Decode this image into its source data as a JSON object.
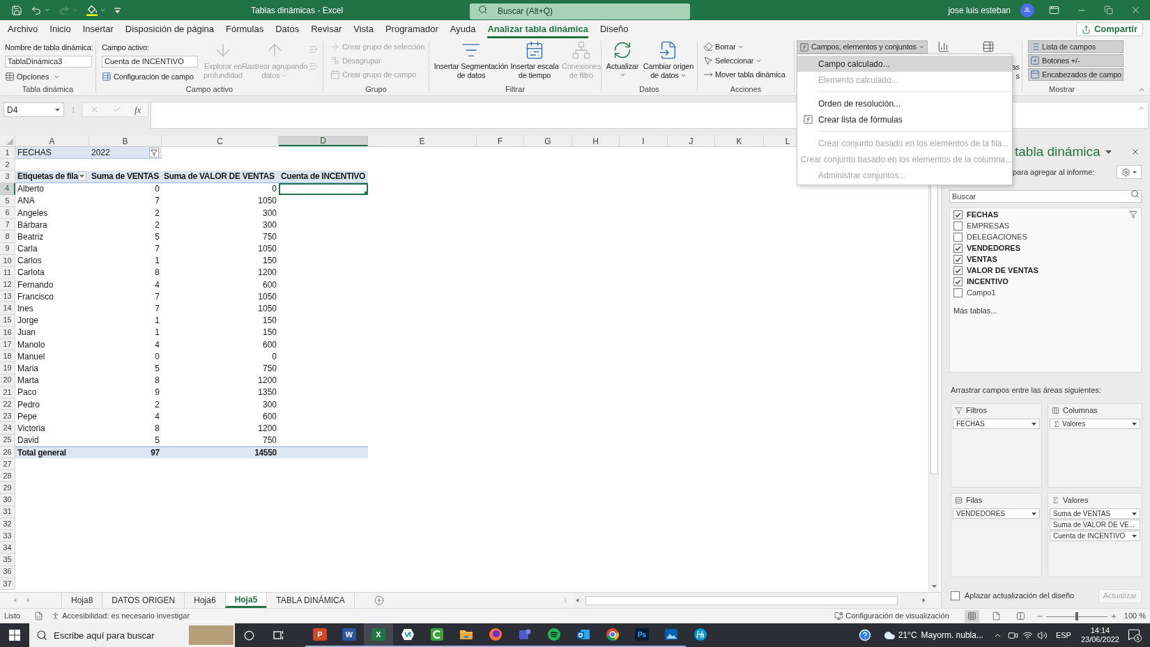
{
  "title_bar": {
    "quick_access": [
      {
        "kind": "save",
        "disabled": false,
        "dropdown": false
      },
      {
        "kind": "undo",
        "disabled": false,
        "dropdown": true
      },
      {
        "kind": "redo",
        "disabled": true,
        "dropdown": true
      },
      {
        "kind": "fill_color",
        "disabled": false,
        "dropdown": true
      },
      {
        "kind": "customize",
        "disabled": false,
        "dropdown": false
      }
    ],
    "title": "Tablas dinámicas - Excel",
    "search": {
      "placeholder": "Buscar (Alt+Q)"
    },
    "user": "jose luis esteban",
    "avatar": "JL"
  },
  "menu_tabs": [
    {
      "label": "Archivo",
      "selected": false
    },
    {
      "label": "Inicio",
      "selected": false
    },
    {
      "label": "Insertar",
      "selected": false
    },
    {
      "label": "Disposición de página",
      "selected": false
    },
    {
      "label": "Fórmulas",
      "selected": false
    },
    {
      "label": "Datos",
      "selected": false
    },
    {
      "label": "Revisar",
      "selected": false
    },
    {
      "label": "Vista",
      "selected": false
    },
    {
      "label": "Programador",
      "selected": false
    },
    {
      "label": "Ayuda",
      "selected": false
    },
    {
      "label": "Analizar tabla dinámica",
      "selected": true
    },
    {
      "label": "Diseño",
      "selected": false
    }
  ],
  "share_button": "Compartir",
  "ribbon": {
    "pivot_table": {
      "label": "Tabla dinámica",
      "name_label": "Nombre de tabla dinámica:",
      "name_value": "TablaDinámica3",
      "options": "Opciones"
    },
    "active_field": {
      "label": "Campo activo",
      "field_label": "Campo activo:",
      "field_value": "Cuenta de INCENTIVO",
      "settings": "Configuración de campo",
      "buttons": [
        {
          "kind": "drill_down",
          "lines": [
            "Explorar en",
            "profundidad"
          ],
          "disabled": true,
          "dropdown": false
        },
        {
          "kind": "drill_up",
          "lines": [
            "Rastrear agrupando",
            "datos"
          ],
          "disabled": true,
          "dropdown": true
        }
      ],
      "expand_disabled": true
    },
    "group": {
      "label": "Grupo",
      "items": [
        {
          "kind": "group_selection",
          "label": "Crear grupo de selección",
          "disabled": true
        },
        {
          "kind": "ungroup",
          "label": "Desagrupar",
          "disabled": true
        },
        {
          "kind": "group_field",
          "label": "Crear grupo de campo",
          "disabled": true
        }
      ]
    },
    "filter": {
      "label": "Filtrar",
      "buttons": [
        {
          "kind": "slicer",
          "lines": [
            "Insertar Segmentación",
            "de datos"
          ],
          "disabled": false,
          "dropdown": false
        },
        {
          "kind": "timeline",
          "lines": [
            "Insertar escala",
            "de tiempo"
          ],
          "disabled": false,
          "dropdown": false
        },
        {
          "kind": "connections",
          "lines": [
            "Conexiones",
            "de filtro"
          ],
          "disabled": true,
          "dropdown": false
        }
      ]
    },
    "data": {
      "label": "Datos",
      "buttons": [
        {
          "kind": "refresh",
          "lines": [
            "Actualizar"
          ],
          "disabled": false,
          "dropdown": true
        },
        {
          "kind": "change_source",
          "lines": [
            "Cambiar origen",
            "de datos"
          ],
          "disabled": false,
          "dropdown": true
        }
      ]
    },
    "actions": {
      "label": "Acciones",
      "items": [
        {
          "kind": "clear",
          "label": "Borrar",
          "dropdown": true
        },
        {
          "kind": "select",
          "label": "Seleccionar",
          "dropdown": true
        },
        {
          "kind": "move",
          "label": "Mover tabla dinámica",
          "dropdown": false
        }
      ]
    },
    "calculations": {
      "button": "Campos, elementos y conjuntos",
      "expanded": true
    },
    "tools": {
      "fragments": [
        "as",
        "s"
      ]
    },
    "show": {
      "label": "Mostrar",
      "items": [
        {
          "kind": "field_list",
          "label": "Lista de campos",
          "on": true
        },
        {
          "kind": "buttons",
          "label": "Botones +/-",
          "on": true
        },
        {
          "kind": "headers",
          "label": "Encabezados de campo",
          "on": true
        }
      ]
    }
  },
  "calc_menu": {
    "sections": [
      [
        {
          "kind": "calculated_field",
          "label": "Campo calculado...",
          "disabled": false,
          "selected": true
        },
        {
          "kind": "calculated_item",
          "label": "Elemento calculado...",
          "disabled": true,
          "selected": false
        }
      ],
      [
        {
          "kind": "solve_order",
          "label": "Orden de resolución...",
          "disabled": false,
          "selected": false
        },
        {
          "kind": "formula_list",
          "label": "Crear lista de fórmulas",
          "disabled": false,
          "selected": false
        }
      ],
      [
        {
          "kind": "row_set",
          "label": "Crear conjunto basado en los elementos de la fila...",
          "disabled": true,
          "selected": false
        },
        {
          "kind": "column_set",
          "label": "Crear conjunto basado en los elementos de la columna...",
          "disabled": true,
          "selected": false
        },
        {
          "kind": "manage_sets",
          "label": "Administrar conjuntos...",
          "disabled": true,
          "selected": false
        }
      ]
    ]
  },
  "formula_bar": {
    "name_box": "D4",
    "function_button": "fx"
  },
  "grid": {
    "columns": [
      {
        "label": "A",
        "selected": false
      },
      {
        "label": "B",
        "selected": false
      },
      {
        "label": "C",
        "selected": false
      },
      {
        "label": "D",
        "selected": true
      },
      {
        "label": "E",
        "selected": false
      },
      {
        "label": "F",
        "selected": false
      },
      {
        "label": "G",
        "selected": false
      },
      {
        "label": "H",
        "selected": false
      },
      {
        "label": "I",
        "selected": false
      },
      {
        "label": "J",
        "selected": false
      },
      {
        "label": "K",
        "selected": false
      },
      {
        "label": "L",
        "selected": false
      }
    ],
    "rows": [
      {
        "number": "1",
        "selected": false,
        "kind": "filter",
        "cells": [
          "FECHAS",
          "2022"
        ]
      },
      {
        "number": "2",
        "selected": false,
        "kind": "blank"
      },
      {
        "number": "3",
        "selected": false,
        "kind": "header",
        "cells": [
          "Etiquetas de fila",
          "Suma de VENTAS",
          "Suma de VALOR DE VENTAS",
          "Cuenta de INCENTIVO"
        ]
      },
      {
        "number": "4",
        "selected": true,
        "kind": "data",
        "cells": [
          "Alberto",
          "0",
          "0"
        ]
      },
      {
        "number": "5",
        "selected": false,
        "kind": "data",
        "cells": [
          "ANA",
          "7",
          "1050"
        ]
      },
      {
        "number": "6",
        "selected": false,
        "kind": "data",
        "cells": [
          "Angeles",
          "2",
          "300"
        ]
      },
      {
        "number": "7",
        "selected": false,
        "kind": "data",
        "cells": [
          "Bárbara",
          "2",
          "300"
        ]
      },
      {
        "number": "8",
        "selected": false,
        "kind": "data",
        "cells": [
          "Beatriz",
          "5",
          "750"
        ]
      },
      {
        "number": "9",
        "selected": false,
        "kind": "data",
        "cells": [
          "Carla",
          "7",
          "1050"
        ]
      },
      {
        "number": "10",
        "selected": false,
        "kind": "data",
        "cells": [
          "Carlos",
          "1",
          "150"
        ]
      },
      {
        "number": "11",
        "selected": false,
        "kind": "data",
        "cells": [
          "Carlota",
          "8",
          "1200"
        ]
      },
      {
        "number": "12",
        "selected": false,
        "kind": "data",
        "cells": [
          "Fernando",
          "4",
          "600"
        ]
      },
      {
        "number": "13",
        "selected": false,
        "kind": "data",
        "cells": [
          "Francisco",
          "7",
          "1050"
        ]
      },
      {
        "number": "14",
        "selected": false,
        "kind": "data",
        "cells": [
          "Ines",
          "7",
          "1050"
        ]
      },
      {
        "number": "15",
        "selected": false,
        "kind": "data",
        "cells": [
          "Jorge",
          "1",
          "150"
        ]
      },
      {
        "number": "16",
        "selected": false,
        "kind": "data",
        "cells": [
          "Juan",
          "1",
          "150"
        ]
      },
      {
        "number": "17",
        "selected": false,
        "kind": "data",
        "cells": [
          "Manolo",
          "4",
          "600"
        ]
      },
      {
        "number": "18",
        "selected": false,
        "kind": "data",
        "cells": [
          "Manuel",
          "0",
          "0"
        ]
      },
      {
        "number": "19",
        "selected": false,
        "kind": "data",
        "cells": [
          "Maria",
          "5",
          "750"
        ]
      },
      {
        "number": "20",
        "selected": false,
        "kind": "data",
        "cells": [
          "Marta",
          "8",
          "1200"
        ]
      },
      {
        "number": "21",
        "selected": false,
        "kind": "data",
        "cells": [
          "Paco",
          "9",
          "1350"
        ]
      },
      {
        "number": "22",
        "selected": false,
        "kind": "data",
        "cells": [
          "Pedro",
          "2",
          "300"
        ]
      },
      {
        "number": "23",
        "selected": false,
        "kind": "data",
        "cells": [
          "Pepe",
          "4",
          "600"
        ]
      },
      {
        "number": "24",
        "selected": false,
        "kind": "data",
        "cells": [
          "Victoria",
          "8",
          "1200"
        ]
      },
      {
        "number": "25",
        "selected": false,
        "kind": "data",
        "cells": [
          "David",
          "5",
          "750"
        ]
      },
      {
        "number": "26",
        "selected": false,
        "kind": "total",
        "cells": [
          "Total general",
          "97",
          "14550"
        ]
      },
      {
        "number": "27",
        "selected": false,
        "kind": "blank"
      },
      {
        "number": "28",
        "selected": false,
        "kind": "blank"
      },
      {
        "number": "29",
        "selected": false,
        "kind": "blank"
      },
      {
        "number": "30",
        "selected": false,
        "kind": "blank"
      },
      {
        "number": "31",
        "selected": false,
        "kind": "blank"
      },
      {
        "number": "32",
        "selected": false,
        "kind": "blank"
      },
      {
        "number": "33",
        "selected": false,
        "kind": "blank"
      },
      {
        "number": "34",
        "selected": false,
        "kind": "blank"
      },
      {
        "number": "35",
        "selected": false,
        "kind": "blank"
      },
      {
        "number": "36",
        "selected": false,
        "kind": "blank"
      },
      {
        "number": "37",
        "selected": false,
        "kind": "blank"
      }
    ]
  },
  "sheet_tabs": [
    {
      "label": "Hoja8",
      "selected": false
    },
    {
      "label": "DATOS ORIGEN",
      "selected": false
    },
    {
      "label": "Hoja6",
      "selected": false
    },
    {
      "label": "Hoja5",
      "selected": true
    },
    {
      "label": "TABLA DINÁMICA",
      "selected": false
    }
  ],
  "field_pane": {
    "title": "tabla dinámica",
    "subtitle": "para agregar al informe:",
    "search": {
      "placeholder": "Buscar"
    },
    "fields": [
      {
        "label": "FECHAS",
        "checked": true,
        "filtered": true
      },
      {
        "label": "EMPRESAS",
        "checked": false,
        "filtered": false
      },
      {
        "label": "DELEGACIONES",
        "checked": false,
        "filtered": false
      },
      {
        "label": "VENDEDORES",
        "checked": true,
        "filtered": false
      },
      {
        "label": "VENTAS",
        "checked": true,
        "filtered": false
      },
      {
        "label": "VALOR DE VENTAS",
        "checked": true,
        "filtered": false
      },
      {
        "label": "INCENTIVO",
        "checked": true,
        "filtered": false
      },
      {
        "label": "Campo1",
        "checked": false,
        "filtered": false
      }
    ],
    "more_tables": "Más tablas...",
    "drag_hint": "Arrastrar campos entre las áreas siguientes:",
    "areas": [
      {
        "kind": "filters",
        "title": "Filtros",
        "items": [
          {
            "kind": "field",
            "label": "FECHAS"
          }
        ]
      },
      {
        "kind": "columns",
        "title": "Columnas",
        "items": [
          {
            "kind": "values",
            "label": "Valores"
          }
        ]
      },
      {
        "kind": "rows",
        "title": "Filas",
        "items": [
          {
            "kind": "field",
            "label": "VENDEDORES"
          }
        ]
      },
      {
        "kind": "values",
        "title": "Valores",
        "items": [
          {
            "kind": "field",
            "label": "Suma de VENTAS"
          },
          {
            "kind": "field",
            "label": "Suma de VALOR DE VE..."
          },
          {
            "kind": "field",
            "label": "Cuenta de INCENTIVO"
          }
        ]
      }
    ],
    "defer": {
      "label": "Aplazar actualización del diseño",
      "checked": false
    },
    "update_button": {
      "label": "Actualizar",
      "disabled": true
    }
  },
  "status_bar": {
    "ready": "Listo",
    "accessibility": "Accesibilidad: es necesario investigar",
    "display_settings": "Configuración de visualización",
    "views": [
      {
        "kind": "normal",
        "selected": true
      },
      {
        "kind": "page_layout",
        "selected": false
      },
      {
        "kind": "page_break",
        "selected": false
      }
    ],
    "zoom": {
      "level": 0.5,
      "reading": "100 %"
    }
  },
  "taskbar": {
    "search": {
      "placeholder": "Escribe aquí para buscar"
    },
    "apps": [
      {
        "kind": "presentation",
        "glyph": "P",
        "active": false,
        "running": true
      },
      {
        "kind": "document",
        "glyph": "W",
        "active": false,
        "running": true
      },
      {
        "kind": "spreadsheet",
        "glyph": "X",
        "active": true,
        "running": true
      },
      {
        "kind": "diamond",
        "active": false,
        "running": true
      },
      {
        "kind": "recorder",
        "active": false,
        "running": true
      },
      {
        "kind": "folder",
        "active": false,
        "running": true
      },
      {
        "kind": "fox_browser",
        "active": false,
        "running": true
      },
      {
        "kind": "chat",
        "active": false,
        "running": true
      },
      {
        "kind": "music",
        "active": false,
        "running": true
      },
      {
        "kind": "mail",
        "active": false,
        "running": true
      },
      {
        "kind": "round_browser",
        "active": false,
        "running": true
      },
      {
        "kind": "photo_editor",
        "glyph": "Ps",
        "active": false,
        "running": true
      },
      {
        "kind": "photos",
        "active": false,
        "running": true
      },
      {
        "kind": "round_logo",
        "active": false,
        "running": false
      }
    ],
    "temperature": "21°C",
    "weather": "Mayorm. nubla...",
    "language": "ESP",
    "time": "14:14",
    "date": "23/06/2022",
    "notifications": "5"
  }
}
